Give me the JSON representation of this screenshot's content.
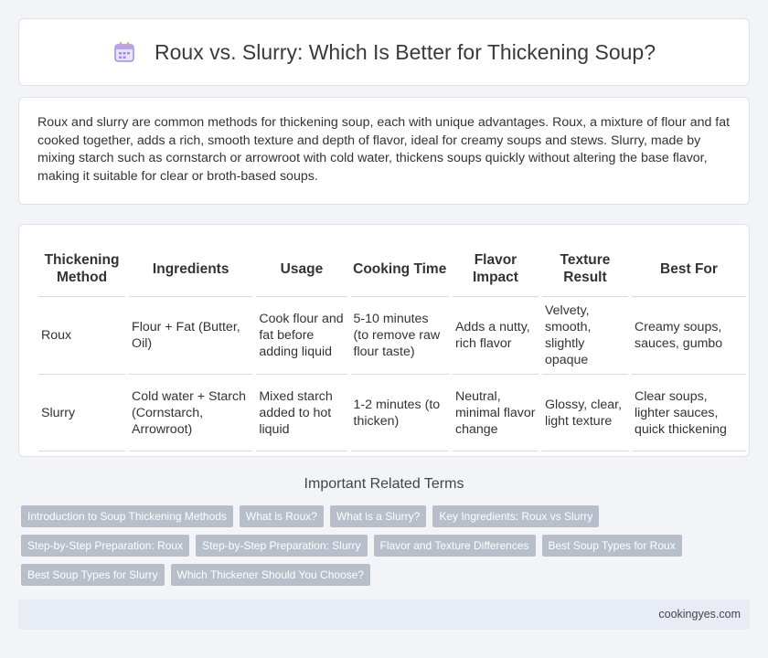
{
  "header": {
    "icon": "calendar-icon",
    "title": "Roux vs. Slurry: Which Is Better for Thickening Soup?"
  },
  "intro": "Roux and slurry are common methods for thickening soup, each with unique advantages. Roux, a mixture of flour and fat cooked together, adds a rich, smooth texture and depth of flavor, ideal for creamy soups and stews. Slurry, made by mixing starch such as cornstarch or arrowroot with cold water, thickens soups quickly without altering the base flavor, making it suitable for clear or broth-based soups.",
  "table": {
    "headers": [
      "Thickening Method",
      "Ingredients",
      "Usage",
      "Cooking Time",
      "Flavor Impact",
      "Texture Result",
      "Best For"
    ],
    "rows": [
      [
        "Roux",
        "Flour + Fat (Butter, Oil)",
        "Cook flour and fat before adding liquid",
        "5-10 minutes (to remove raw flour taste)",
        "Adds a nutty, rich flavor",
        "Velvety, smooth, slightly opaque",
        "Creamy soups, sauces, gumbo"
      ],
      [
        "Slurry",
        "Cold water + Starch (Cornstarch, Arrowroot)",
        "Mixed starch added to hot liquid",
        "1-2 minutes (to thicken)",
        "Neutral, minimal flavor change",
        "Glossy, clear, light texture",
        "Clear soups, lighter sauces, quick thickening"
      ]
    ]
  },
  "related": {
    "heading": "Important Related Terms",
    "tags": [
      [
        "Introduction to Soup Thickening Methods",
        "What is Roux?",
        "What is a Slurry?",
        "Key Ingredients: Roux vs Slurry"
      ],
      [
        "Step-by-Step Preparation: Roux",
        "Step-by-Step Preparation: Slurry",
        "Flavor and Texture Differences",
        "Best Soup Types for Roux"
      ],
      [
        "Best Soup Types for Slurry",
        "Which Thickener Should You Choose?"
      ]
    ]
  },
  "footer": {
    "site": "cookingyes.com"
  },
  "colors": {
    "tag_bg": "#b8bfcb",
    "footer_bg": "#e8ecf4",
    "page_bg": "#f3f4f7"
  }
}
